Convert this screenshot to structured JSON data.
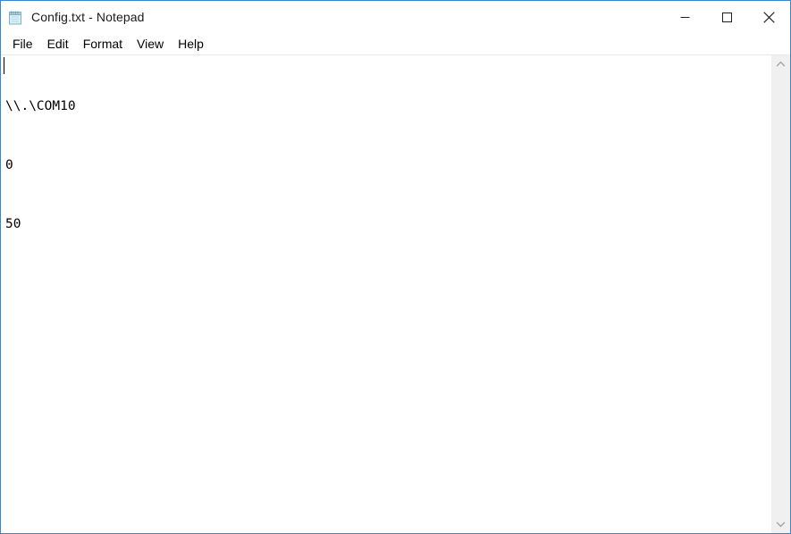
{
  "window": {
    "title": "Config.txt - Notepad",
    "accent_border_color": "#3a86c8",
    "background_color": "#ffffff"
  },
  "titlebar": {
    "icon": "notepad-icon",
    "buttons": [
      {
        "name": "minimize",
        "label": "Minimize",
        "glyph": "minimize-icon"
      },
      {
        "name": "maximize",
        "label": "Maximize",
        "glyph": "maximize-icon"
      },
      {
        "name": "close",
        "label": "Close",
        "glyph": "close-icon"
      }
    ]
  },
  "menubar": {
    "items": [
      {
        "label": "File"
      },
      {
        "label": "Edit"
      },
      {
        "label": "Format"
      },
      {
        "label": "View"
      },
      {
        "label": "Help"
      }
    ]
  },
  "editor": {
    "text_color": "#000000",
    "background_color": "#ffffff",
    "caret_line": 1,
    "caret_column": 1,
    "lines": [
      "\\\\.\\COM10",
      "0",
      "50"
    ]
  },
  "scrollbar": {
    "track_color": "#f0f0f0",
    "arrow_color": "#a0a0a0",
    "up_arrow": "chevron-up-icon",
    "down_arrow": "chevron-down-icon"
  }
}
